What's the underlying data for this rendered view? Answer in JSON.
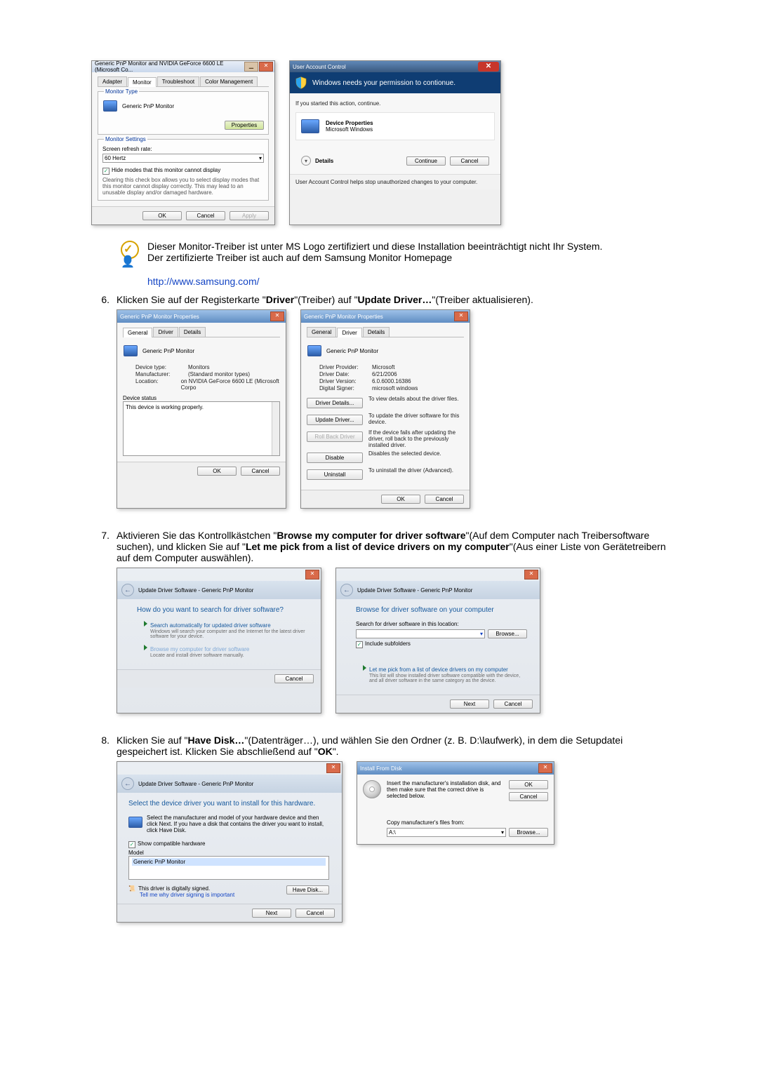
{
  "monitor_dialog": {
    "title": "Generic PnP Monitor and NVIDIA GeForce 6600 LE (Microsoft Co...",
    "tabs": {
      "adapter": "Adapter",
      "monitor": "Monitor",
      "troubleshoot": "Troubleshoot",
      "color": "Color Management"
    },
    "monitor_type_label": "Monitor Type",
    "monitor_name": "Generic PnP Monitor",
    "properties_btn": "Properties",
    "monitor_settings_label": "Monitor Settings",
    "refresh_label": "Screen refresh rate:",
    "refresh_value": "60 Hertz",
    "hide_modes": "Hide modes that this monitor cannot display",
    "hide_modes_desc": "Clearing this check box allows you to select display modes that this monitor cannot display correctly. This may lead to an unusable display and/or damaged hardware.",
    "ok": "OK",
    "cancel": "Cancel",
    "apply": "Apply"
  },
  "uac": {
    "title": "User Account Control",
    "headline": "Windows needs your permission to contionue.",
    "started": "If you started this action, continue.",
    "prog_name": "Device Properties",
    "publisher": "Microsoft Windows",
    "details": "Details",
    "continue": "Continue",
    "cancel": "Cancel",
    "footer": "User Account Control helps stop unauthorized changes to your computer."
  },
  "note": {
    "line1": "Dieser Monitor-Treiber ist unter MS Logo zertifiziert und diese Installation beeinträchtigt nicht Ihr System.",
    "line2": "Der zertifizierte Treiber ist auch auf dem Samsung Monitor Homepage",
    "link": "http://www.samsung.com/"
  },
  "step6": {
    "num": "6.",
    "text_a": "Klicken Sie auf der Registerkarte \"",
    "bold_a": "Driver",
    "text_b": "\"(Treiber) auf \"",
    "bold_b": "Update Driver…",
    "text_c": "\"(Treiber aktualisieren).",
    "props1": {
      "title": "Generic PnP Monitor Properties",
      "tabs": {
        "general": "General",
        "driver": "Driver",
        "details": "Details"
      },
      "name": "Generic PnP Monitor",
      "kv": [
        {
          "k": "Device type:",
          "v": "Monitors"
        },
        {
          "k": "Manufacturer:",
          "v": "(Standard monitor types)"
        },
        {
          "k": "Location:",
          "v": "on NVIDIA GeForce 6600 LE (Microsoft Corpo"
        }
      ],
      "status_label": "Device status",
      "status_text": "This device is working properly.",
      "ok": "OK",
      "cancel": "Cancel"
    },
    "props2": {
      "title": "Generic PnP Monitor Properties",
      "tabs": {
        "general": "General",
        "driver": "Driver",
        "details": "Details"
      },
      "name": "Generic PnP Monitor",
      "kv": [
        {
          "k": "Driver Provider:",
          "v": "Microsoft"
        },
        {
          "k": "Driver Date:",
          "v": "6/21/2006"
        },
        {
          "k": "Driver Version:",
          "v": "6.0.6000.16386"
        },
        {
          "k": "Digital Signer:",
          "v": "microsoft windows"
        }
      ],
      "buttons": [
        {
          "b": "Driver Details...",
          "d": "To view details about the driver files."
        },
        {
          "b": "Update Driver...",
          "d": "To update the driver software for this device."
        },
        {
          "b": "Roll Back Driver",
          "d": "If the device fails after updating the driver, roll back to the previously installed driver."
        },
        {
          "b": "Disable",
          "d": "Disables the selected device."
        },
        {
          "b": "Uninstall",
          "d": "To uninstall the driver (Advanced)."
        }
      ],
      "ok": "OK",
      "cancel": "Cancel"
    }
  },
  "step7": {
    "num": "7.",
    "text_a": "Aktivieren Sie das Kontrollkästchen \"",
    "bold_a": "Browse my computer for driver software",
    "text_b": "\"(Auf dem Computer nach Treibersoftware suchen), und klicken Sie auf \"",
    "bold_b": "Let me pick from a list of device drivers on my computer",
    "text_c": "\"(Aus einer Liste von Gerätetreibern auf dem Computer auswählen).",
    "wiz1": {
      "crumb": "Update Driver Software - Generic PnP Monitor",
      "q": "How do you want to search for driver software?",
      "opt1_t": "Search automatically for updated driver software",
      "opt1_s": "Windows will search your computer and the Internet for the latest driver software for your device.",
      "opt2_t": "Browse my computer for driver software",
      "opt2_s": "Locate and install driver software manually.",
      "cancel": "Cancel"
    },
    "wiz2": {
      "crumb": "Update Driver Software - Generic PnP Monitor",
      "q": "Browse for driver software on your computer",
      "loc_label": "Search for driver software in this location:",
      "path": "",
      "browse": "Browse...",
      "include": "Include subfolders",
      "opt_t": "Let me pick from a list of device drivers on my computer",
      "opt_s": "This list will show installed driver software compatible with the device, and all driver software in the same category as the device.",
      "next": "Next",
      "cancel": "Cancel"
    }
  },
  "step8": {
    "num": "8.",
    "text_a": "Klicken Sie auf \"",
    "bold_a": "Have Disk…",
    "text_b": "\"(Datenträger…), und wählen Sie den Ordner (z. B. D:\\laufwerk), in dem die Setupdatei gespeichert ist. Klicken Sie abschließend auf \"",
    "bold_b": "OK",
    "text_c": "\".",
    "wiz": {
      "crumb": "Update Driver Software - Generic PnP Monitor",
      "q": "Select the device driver you want to install for this hardware.",
      "sub": "Select the manufacturer and model of your hardware device and then click Next. If you have a disk that contains the driver you want to install, click Have Disk.",
      "compat": "Show compatible hardware",
      "model": "Model",
      "item": "Generic PnP Monitor",
      "signed": "This driver is digitally signed.",
      "why": "Tell me why driver signing is important",
      "have_disk": "Have Disk...",
      "next": "Next",
      "cancel": "Cancel"
    },
    "ifd": {
      "title": "Install From Disk",
      "msg": "Insert the manufacturer's installation disk, and then make sure that the correct drive is selected below.",
      "ok": "OK",
      "cancel": "Cancel",
      "copy": "Copy manufacturer's files from:",
      "drive": "A:\\",
      "browse": "Browse..."
    }
  }
}
